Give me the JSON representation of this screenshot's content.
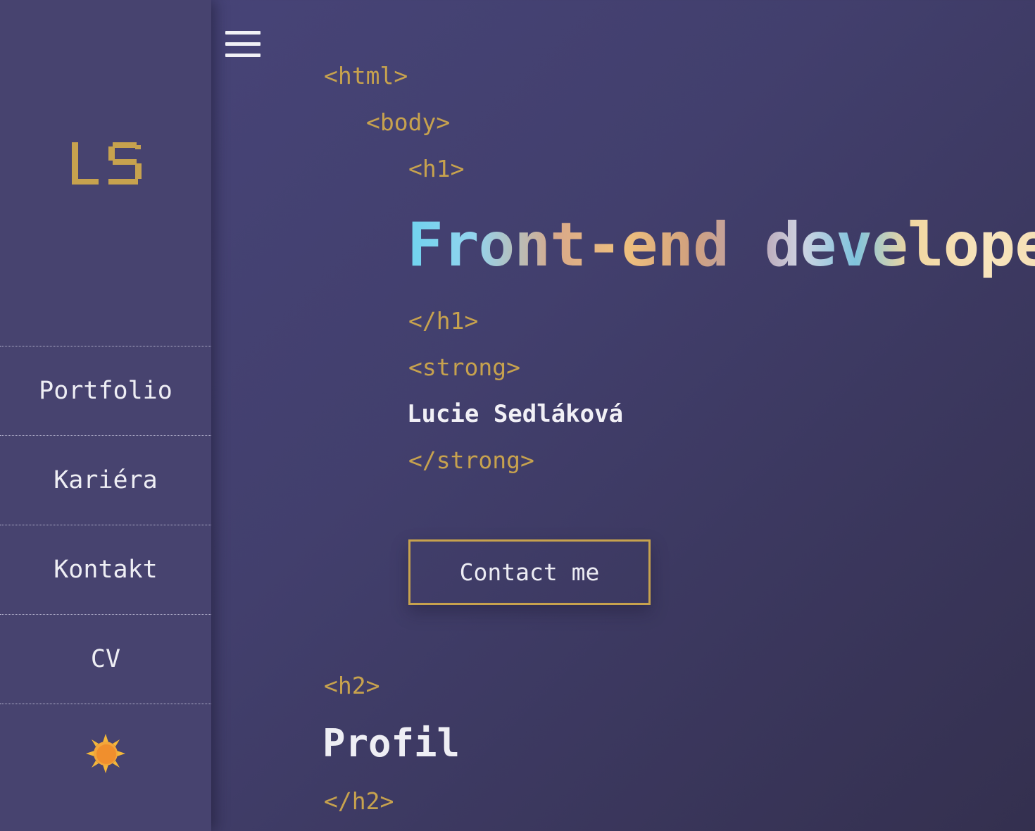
{
  "colors": {
    "accent": "#c7a24e",
    "sidebar_bg": "#47436f",
    "text": "#eeeef4"
  },
  "logo": {
    "text": "LS"
  },
  "nav": {
    "items": [
      {
        "label": "Portfolio"
      },
      {
        "label": "Kariéra"
      },
      {
        "label": "Kontakt"
      },
      {
        "label": "CV"
      }
    ],
    "theme_icon": "sun-icon"
  },
  "header": {
    "menu_icon": "hamburger-menu-icon"
  },
  "hero": {
    "tag_html_open": "<html>",
    "tag_body_open": "<body>",
    "tag_h1_open": "<h1>",
    "title": "Front-end developer",
    "tag_h1_close": "</h1>",
    "tag_strong_open": "<strong>",
    "name": "Lucie Sedláková",
    "tag_strong_close": "</strong>",
    "cta_label": "Contact me"
  },
  "profile": {
    "tag_h2_open": "<h2>",
    "title": "Profil",
    "tag_h2_close": "</h2>"
  }
}
